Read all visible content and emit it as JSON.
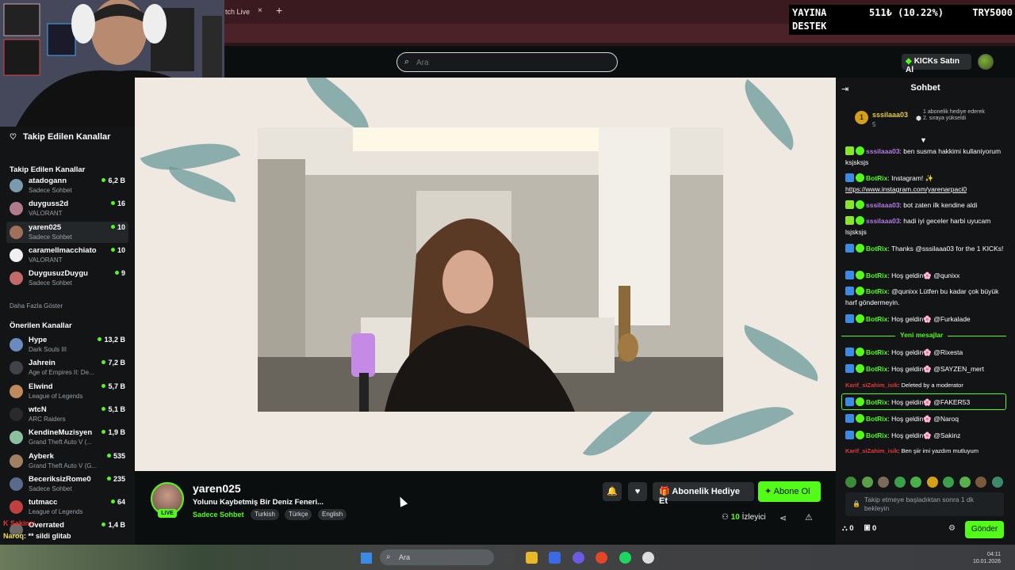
{
  "browser": {
    "tab_label": "tch Live",
    "tab_close": "×",
    "new_tab": "+"
  },
  "donation_overlay": {
    "line1": "YAYINA",
    "line2": "DESTEK",
    "amount": "511₺ (10.22%)",
    "goal": "TRY5000"
  },
  "header": {
    "search_placeholder": "Ara",
    "kicks_button": "KICKs Satın Al"
  },
  "sidebar": {
    "title": "Takip Edilen Kanallar",
    "followed_section": "Takip Edilen Kanallar",
    "followed": [
      {
        "name": "atadogann",
        "category": "Sadece Sohbet",
        "viewers": "6,2 B",
        "color": "#7a9ab0"
      },
      {
        "name": "duyguss2d",
        "category": "VALORANT",
        "viewers": "16",
        "color": "#b07a8a"
      },
      {
        "name": "yaren025",
        "category": "Sadece Sohbet",
        "viewers": "10",
        "color": "#a0705a"
      },
      {
        "name": "caramellmacchiato",
        "category": "VALORANT",
        "viewers": "10",
        "color": "#f0f0f0"
      },
      {
        "name": "DuygusuzDuygu",
        "category": "Sadece Sohbet",
        "viewers": "9",
        "color": "#c06a6a"
      }
    ],
    "show_more": "Daha Fazla Göster",
    "recommended_section": "Önerilen Kanallar",
    "recommended": [
      {
        "name": "Hype",
        "category": "Dark Souls III",
        "viewers": "13,2 B",
        "color": "#6a8ac0"
      },
      {
        "name": "Jahrein",
        "category": "Age of Empires II: De...",
        "viewers": "7,2 B",
        "color": "#404448"
      },
      {
        "name": "Elwind",
        "category": "League of Legends",
        "viewers": "5,7 B",
        "color": "#c08a5a"
      },
      {
        "name": "wtcN",
        "category": "ARC Raiders",
        "viewers": "5,1 B",
        "color": "#2a2a2a"
      },
      {
        "name": "KendineMuzisyen",
        "category": "Grand Theft Auto V (...",
        "viewers": "1,9 B",
        "color": "#8ac0a0"
      },
      {
        "name": "Ayberk",
        "category": "Grand Theft Auto V (G...",
        "viewers": "535",
        "color": "#a08060"
      },
      {
        "name": "BeceriksizRome0",
        "category": "Sadece Sohbet",
        "viewers": "235",
        "color": "#5a6a8a"
      },
      {
        "name": "tutmacc",
        "category": "League of Legends",
        "viewers": "64",
        "color": "#c04040"
      },
      {
        "name": "Overrated",
        "category": "",
        "viewers": "1,4 B",
        "color": "#6a6a6a"
      }
    ]
  },
  "overlay_chat": {
    "line1": "K Sakinz: ",
    "line2_user": "Naroq",
    "line2_text": ": ** sildi glitab"
  },
  "stream": {
    "name": "yaren025",
    "live": "LIVE",
    "title": "Yolunu Kaybetmiş Bir Deniz Feneri...",
    "category": "Sadece Sohbet",
    "tags": [
      "Turkish",
      "Türkçe",
      "English"
    ],
    "gift_button": "Abonelik Hediye Et",
    "subscribe_button": "Abone Ol",
    "viewers_count": "10",
    "viewers_label": "İzleyici"
  },
  "chat": {
    "title": "Sohbet",
    "pinned": {
      "rank": "1",
      "user": "sssilaaa03",
      "count": "5",
      "text": "1 abonelik hediye ederek 2. sıraya yükseldi"
    },
    "messages": [
      {
        "user": "sssilaaa03",
        "user_color": "#b87ae6",
        "text": ": ben susma hakkimi kullaniyorum ksjsksjs",
        "badge_color": "#8ae62a"
      },
      {
        "user": "BotRix",
        "user_color": "#53fc18",
        "text": ": Instagram! ✨",
        "link": "https://www.instagram.com/yarenarpaci0",
        "badge_color": "#3a8ae6"
      },
      {
        "user": "sssilaaa03",
        "user_color": "#b87ae6",
        "text": ": bot zaten ilk kendine aldi",
        "badge_color": "#8ae62a"
      },
      {
        "user": "sssilaaa03",
        "user_color": "#b87ae6",
        "text": ": hadi iyi geceler harbi uyucam lsjsksjs",
        "badge_color": "#8ae62a"
      },
      {
        "user": "BotRix",
        "user_color": "#53fc18",
        "text": ": Thanks @sssilaaa03 for the 1 KICKs!",
        "badge_color": "#3a8ae6"
      },
      {
        "user": "BotRix",
        "user_color": "#53fc18",
        "text": ": Hoş geldin🌸 @qunixx",
        "badge_color": "#3a8ae6"
      },
      {
        "user": "BotRix",
        "user_color": "#53fc18",
        "text": ": @qunixx Lütfen bu kadar çok büyük harf göndermeyin.",
        "badge_color": "#3a8ae6"
      },
      {
        "user": "BotRix",
        "user_color": "#53fc18",
        "text": ": Hoş geldin🌸 @Furkalade",
        "badge_color": "#3a8ae6"
      }
    ],
    "new_messages_label": "Yeni mesajlar",
    "messages_after": [
      {
        "user": "BotRix",
        "user_color": "#53fc18",
        "text": ": Hoş geldin🌸 @Rixesta",
        "badge_color": "#3a8ae6"
      },
      {
        "user": "BotRix",
        "user_color": "#53fc18",
        "text": ": Hoş geldin🌸 @SAYZEN_mert",
        "badge_color": "#3a8ae6"
      },
      {
        "user": "Karif_siZahim_isik",
        "user_color": "#e03a3a",
        "text": ": Deleted by a moderator",
        "badge_color": ""
      },
      {
        "user": "BotRix",
        "user_color": "#53fc18",
        "text": ": Hoş geldin🌸 @FAKER53",
        "badge_color": "#3a8ae6"
      },
      {
        "user": "BotRix",
        "user_color": "#53fc18",
        "text": ": Hoş geldin🌸 @Naroq",
        "badge_color": "#3a8ae6"
      },
      {
        "user": "BotRix",
        "user_color": "#53fc18",
        "text": ": Hoş geldin🌸 @Sakinz",
        "badge_color": "#3a8ae6"
      },
      {
        "user": "Karif_siZahim_isik",
        "user_color": "#e03a3a",
        "text": ": Ben şiir imi yazdım mutluyum",
        "badge_color": ""
      }
    ],
    "input_placeholder": "Takip etmeye başladıktan sonra 1 dk bekleyin",
    "kicks_count": "0",
    "gifts_count": "0",
    "send_button": "Gönder"
  },
  "taskbar": {
    "search_placeholder": "Ara",
    "time": "04:11",
    "date": "10.01.2026"
  },
  "colors": {
    "accent": "#53fc18",
    "background": "#0b0e0f",
    "panel": "#121416"
  }
}
